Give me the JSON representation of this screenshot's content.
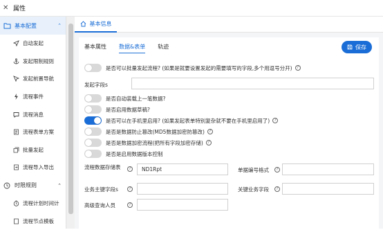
{
  "window": {
    "title": "属性",
    "close_icon": "close-icon"
  },
  "sidebar": {
    "group_basic": {
      "label": "基本配置",
      "icon": "folder-icon"
    },
    "items": [
      {
        "label": "自动发起",
        "icon": "send-icon"
      },
      {
        "label": "发起限制规则",
        "icon": "anchor-icon"
      },
      {
        "label": "发起前置导航",
        "icon": "navigation-icon"
      },
      {
        "label": "流程事件",
        "icon": "lightning-icon"
      },
      {
        "label": "流程消息",
        "icon": "message-icon"
      },
      {
        "label": "流程表单方案",
        "icon": "form-icon"
      },
      {
        "label": "批量发起",
        "icon": "batch-icon"
      },
      {
        "label": "流程导入导出",
        "icon": "import-export-icon"
      }
    ],
    "group_time": {
      "label": "时限规则",
      "icon": "clock-icon"
    },
    "time_items": [
      {
        "label": "流程计划时间计",
        "icon": "timer-icon"
      },
      {
        "label": "流程节点模板",
        "icon": "template-icon"
      }
    ]
  },
  "tabbar": {
    "home_tab": "基本信息"
  },
  "subtabs": [
    "基本属性",
    "数据&表单",
    "轨迹"
  ],
  "save_button": "保存",
  "rows": {
    "batch_start": "是否可以批量发起流程? (如果是就要设置发起的需要填写的字段,多个用逗号分开)",
    "start_fields_label": "发起字段s",
    "auto_load": "是否自动装载上一笔数据?",
    "enable_draft": "是否启用数据草稿?",
    "mobile_start": "是否可以在手机里启用? (如果发起表单特别复杂就不要在手机里启用了)",
    "prevent_tamper": "是否是数据防止篡改(MD5数据加密防篡改)",
    "encrypt_storage": "是否是数据加密流程(把所有字段加密存储)",
    "version_control": "是否是启用数据版本控制"
  },
  "toggles": {
    "batch_start": false,
    "auto_load": false,
    "enable_draft": false,
    "mobile_start": true,
    "prevent_tamper": false,
    "encrypt_storage": false,
    "version_control": false
  },
  "fields": {
    "storage_table_label": "流程数据存储表",
    "storage_table_value": "ND1Rpt",
    "bill_format_label": "单据编号格式",
    "bill_format_value": "",
    "business_key_label": "业务主键字段s",
    "business_key_value": "",
    "related_field_label": "关键业务字段",
    "related_field_value": "",
    "advanced_query_label": "高级查询人员",
    "advanced_query_value": ""
  },
  "colors": {
    "accent": "#1a6dd6",
    "active_bg": "#e8f1fb"
  }
}
